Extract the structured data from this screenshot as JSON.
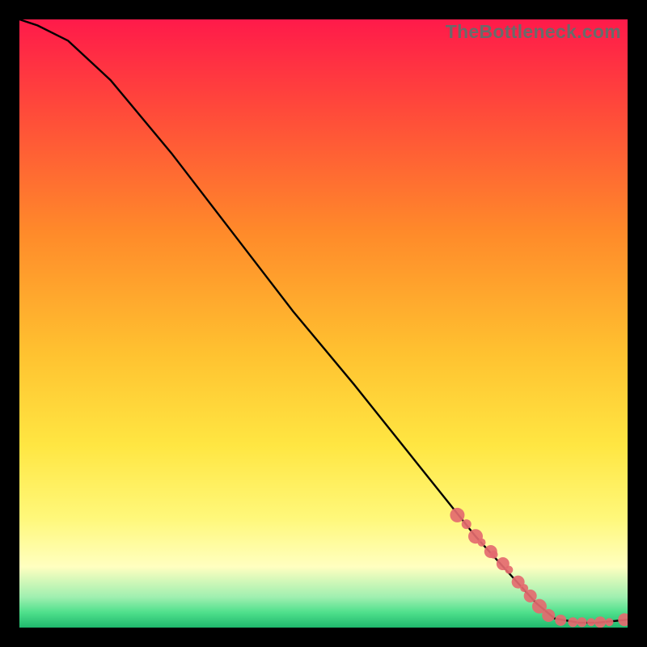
{
  "watermark": "TheBottleneck.com",
  "colors": {
    "frame_bg": "#000000",
    "curve": "#000000",
    "marker_fill": "#e46a6f",
    "marker_outline": "#e46a6f",
    "gradient_top": "#ff1a4a",
    "gradient_mid1": "#ff8a2a",
    "gradient_mid2": "#ffe642",
    "gradient_mid3": "#ffffa8",
    "gradient_low": "#4fe08c",
    "gradient_bottom": "#1fb86d"
  },
  "chart_data": {
    "type": "line",
    "title": "",
    "xlabel": "",
    "ylabel": "",
    "xlim": [
      0,
      100
    ],
    "ylim": [
      0,
      100
    ],
    "series": [
      {
        "name": "curve",
        "x": [
          0,
          3,
          8,
          15,
          25,
          35,
          45,
          55,
          65,
          75,
          85,
          88,
          92,
          95,
          100
        ],
        "y": [
          100,
          99,
          96.5,
          90,
          78,
          65,
          52,
          40,
          27.5,
          15,
          4,
          1.5,
          0.8,
          0.8,
          1.3
        ]
      }
    ],
    "markers": {
      "name": "highlight-points",
      "x": [
        72,
        73.5,
        75,
        76,
        77.5,
        78,
        79.5,
        80.5,
        82,
        83,
        84,
        85.5,
        87,
        89,
        91,
        92.5,
        94,
        95.5,
        97,
        99.5
      ],
      "y": [
        18.5,
        17,
        15,
        14,
        12.5,
        12,
        10.5,
        9.5,
        7.5,
        6.5,
        5.2,
        3.5,
        2,
        1.2,
        0.9,
        0.9,
        0.9,
        0.9,
        0.9,
        1.3
      ],
      "r": [
        9,
        6,
        9,
        5,
        8,
        5,
        8,
        5,
        8,
        5,
        8,
        9,
        8,
        7,
        6,
        6,
        5,
        7,
        5,
        8
      ]
    },
    "gradient_stops": [
      {
        "offset": 0.0,
        "color": "#ff1a4a"
      },
      {
        "offset": 0.15,
        "color": "#ff4a3a"
      },
      {
        "offset": 0.35,
        "color": "#ff8a2a"
      },
      {
        "offset": 0.55,
        "color": "#ffc230"
      },
      {
        "offset": 0.7,
        "color": "#ffe642"
      },
      {
        "offset": 0.82,
        "color": "#fff87a"
      },
      {
        "offset": 0.9,
        "color": "#ffffc0"
      },
      {
        "offset": 0.95,
        "color": "#9fefb0"
      },
      {
        "offset": 0.975,
        "color": "#4fe08c"
      },
      {
        "offset": 1.0,
        "color": "#1fb86d"
      }
    ]
  }
}
